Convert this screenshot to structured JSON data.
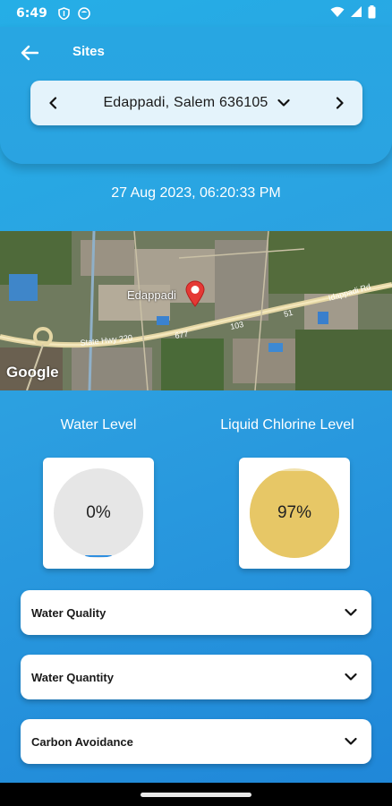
{
  "status_bar": {
    "time": "6:49",
    "icons": [
      "shield-icon",
      "smiley-icon"
    ],
    "right_icons": [
      "wifi-icon",
      "signal-icon",
      "battery-icon"
    ]
  },
  "header": {
    "back_icon": "arrow-left-icon",
    "title": "Sites"
  },
  "site_selector": {
    "prev_icon": "chevron-left-icon",
    "site": "Edappadi, Salem 636105",
    "dropdown_icon": "chevron-down-icon",
    "next_icon": "chevron-right-icon"
  },
  "timestamp": "27 Aug 2023, 06:20:33 PM",
  "map": {
    "place_label": "Edappadi",
    "road_labels": [
      "State Hwy 220",
      "677",
      "103",
      "51",
      "Idappadi Rd"
    ],
    "logo": "Google",
    "pin_icon": "map-pin-icon"
  },
  "levels": {
    "water": {
      "title": "Water Level",
      "value": "0%",
      "fraction": 0.0,
      "color": "#e6e6e6",
      "accent": "#2f8fe0"
    },
    "chlorine": {
      "title": "Liquid Chlorine Level",
      "value": "97%",
      "fraction": 0.97,
      "color": "#e7c766"
    }
  },
  "accordions": [
    {
      "label": "Water Quality"
    },
    {
      "label": "Water Quantity"
    },
    {
      "label": "Carbon Avoidance"
    }
  ]
}
